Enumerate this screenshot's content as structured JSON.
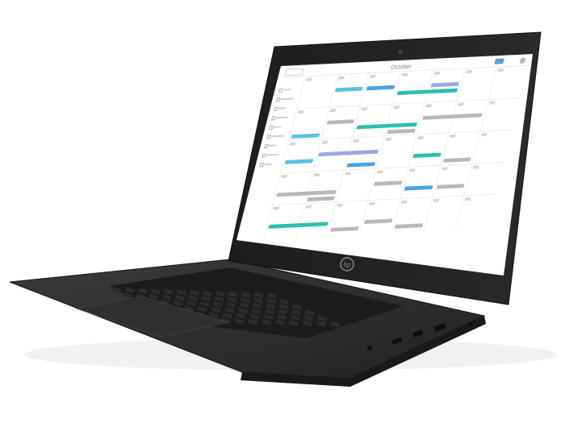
{
  "scene": {
    "description_colors": {
      "background": "#ffffff",
      "laptop_body": "#2b2b2d",
      "screen_bezel": "#1e1e20"
    },
    "logo": "hp",
    "screen_app": {
      "type": "calendar",
      "month_title": "October",
      "event_colors": [
        "#5bc0e8",
        "#4aa3e0",
        "#2dbfb0",
        "#9aa6e8",
        "#b8b8b8"
      ]
    }
  }
}
